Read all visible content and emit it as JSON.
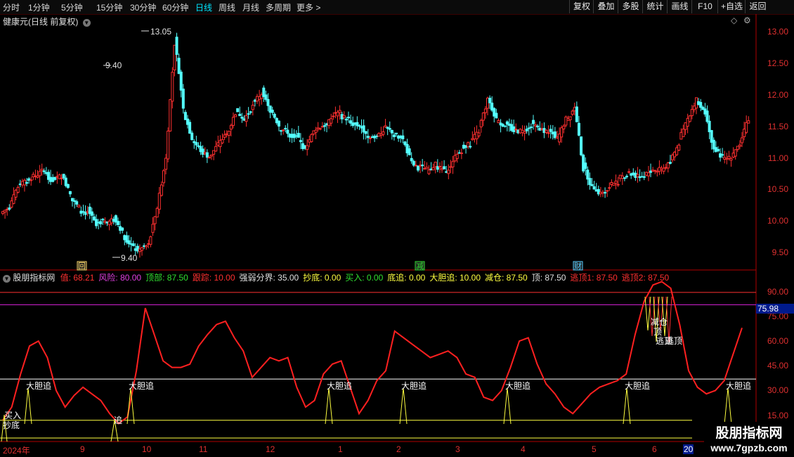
{
  "toolbar": {
    "periods": [
      "分时",
      "1分钟",
      "5分钟",
      "15分钟",
      "30分钟",
      "60分钟",
      "日线",
      "周线",
      "月线",
      "多周期",
      "更多 >"
    ],
    "active_period": "日线",
    "buttons": [
      "复权",
      "叠加",
      "多股",
      "统计",
      "画线",
      "F10",
      "+自选",
      "返回"
    ]
  },
  "chart_title": "健康元(日线 前复权)",
  "watermark": {
    "title": "股朋指标网",
    "url": "www.7gpzb.com"
  },
  "main_chart": {
    "high_label": "13.05",
    "low_label": "9.40",
    "y_ticks": [
      "13.00",
      "12.50",
      "12.00",
      "11.50",
      "11.00",
      "10.50",
      "10.00",
      "9.50"
    ],
    "markers": [
      "回",
      "减",
      "财"
    ]
  },
  "indicator": {
    "name": "股朋指标网",
    "fields": [
      {
        "label": "值: 68.21",
        "color": "#ff3030"
      },
      {
        "label": "风险: 80.00",
        "color": "#e040e0"
      },
      {
        "label": "顶部: 87.50",
        "color": "#30e030"
      },
      {
        "label": "跟踪: 10.00",
        "color": "#ff3030"
      },
      {
        "label": "强弱分界: 35.00",
        "color": "#e0e0e0"
      },
      {
        "label": "抄底: 0.00",
        "color": "#ffff40"
      },
      {
        "label": "买入: 0.00",
        "color": "#30e030"
      },
      {
        "label": "底追: 0.00",
        "color": "#ffff40"
      },
      {
        "label": "大胆追: 10.00",
        "color": "#ffff40"
      },
      {
        "label": "减仓: 87.50",
        "color": "#ffff40"
      },
      {
        "label": "顶: 87.50",
        "color": "#e0e0e0"
      },
      {
        "label": "逃顶1: 87.50",
        "color": "#ff3030"
      },
      {
        "label": "逃顶2: 87.50",
        "color": "#ff3030"
      }
    ],
    "y_ticks": [
      "90.00",
      "75.00",
      "60.00",
      "45.00",
      "30.00",
      "15.00"
    ],
    "current_value": "75.98",
    "signals": {
      "bold_chase": "大胆追",
      "chase": "追",
      "buy": "买入",
      "bottom": "抄底",
      "reduce": "减仓",
      "top": "顶",
      "escape1": "逃顶",
      "escape2": "逃顶"
    }
  },
  "x_axis": [
    "2024年",
    "9",
    "10",
    "11",
    "12",
    "1",
    "2",
    "3",
    "4",
    "5",
    "6",
    "20"
  ],
  "chart_data": {
    "type": "line",
    "title": "股朋指标网",
    "series": [
      {
        "name": "值",
        "values": [
          10,
          18,
          38,
          55,
          58,
          48,
          28,
          18,
          25,
          30,
          26,
          22,
          14,
          8,
          12,
          40,
          78,
          62,
          46,
          42,
          42,
          44,
          55,
          62,
          68,
          70,
          60,
          52,
          36,
          42,
          48,
          46,
          48,
          30,
          18,
          22,
          38,
          44,
          46,
          30,
          14,
          22,
          34,
          40,
          64,
          60,
          56,
          52,
          48,
          50,
          52,
          48,
          38,
          36,
          24,
          22,
          28,
          42,
          58,
          60,
          44,
          32,
          26,
          18,
          14,
          20,
          26,
          30,
          32,
          34,
          38,
          62,
          82,
          92,
          94,
          90,
          68,
          40,
          30,
          26,
          28,
          34,
          50,
          66
        ]
      }
    ],
    "levels": {
      "风险": 80,
      "顶部": 87.5,
      "强弱分界": 35,
      "跟踪": 10,
      "当前": 75.98
    },
    "ylim": [
      10,
      95
    ]
  }
}
